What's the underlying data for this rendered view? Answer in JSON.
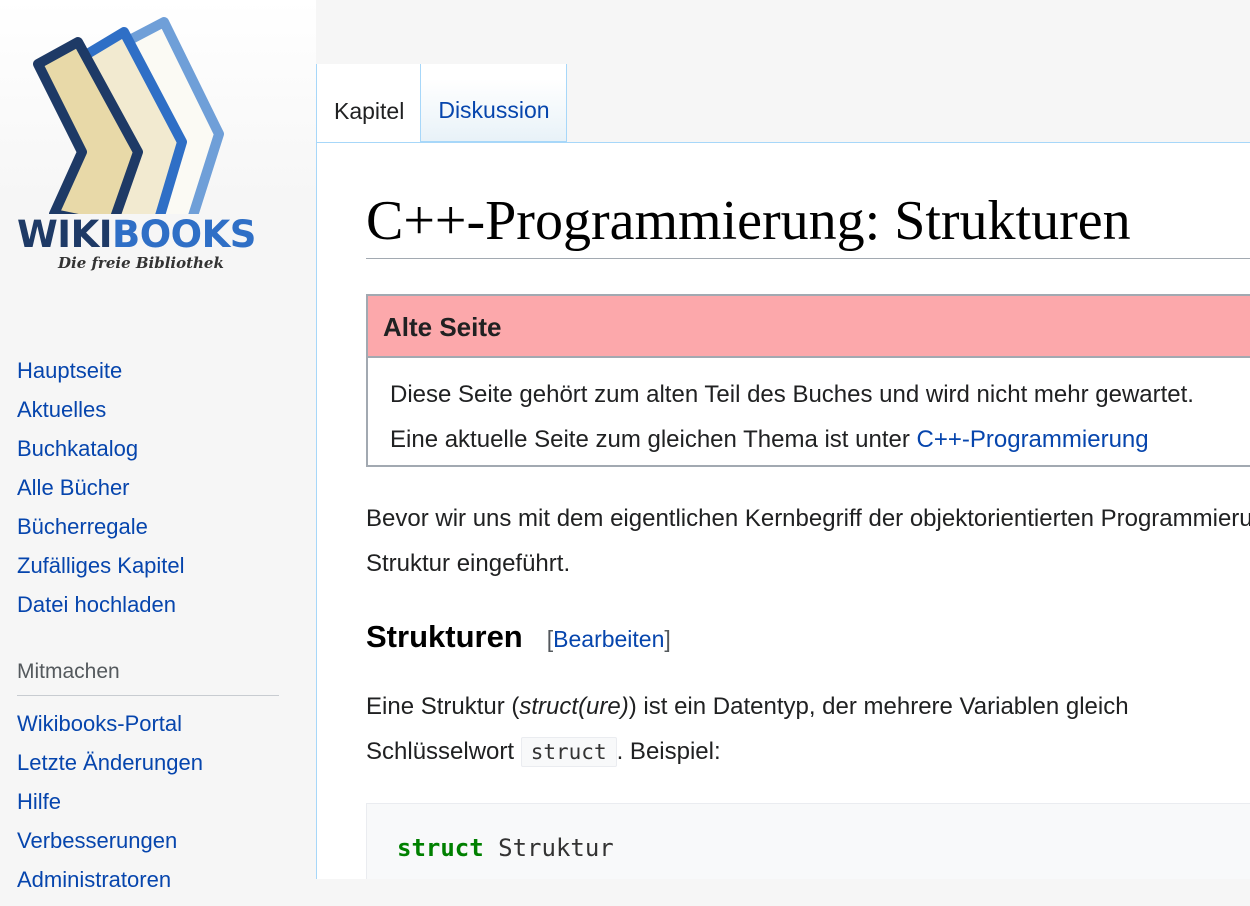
{
  "logo": {
    "wordmark_part1": "WIKI",
    "wordmark_part2": "BOOKS",
    "tagline": "Die freie Bibliothek",
    "colors": {
      "dark_blue": "#1e3a66",
      "mid_blue": "#2f6fc6",
      "light_blue": "#6f9fd8",
      "cream": "#f2ead0"
    }
  },
  "sidebar": {
    "main_items": [
      {
        "label": "Hauptseite"
      },
      {
        "label": "Aktuelles"
      },
      {
        "label": "Buchkatalog"
      },
      {
        "label": "Alle Bücher"
      },
      {
        "label": "Bücherregale"
      },
      {
        "label": "Zufälliges Kapitel"
      },
      {
        "label": "Datei hochladen"
      }
    ],
    "mitmachen_heading": "Mitmachen",
    "mitmachen_items": [
      {
        "label": "Wikibooks-Portal"
      },
      {
        "label": "Letzte Änderungen"
      },
      {
        "label": "Hilfe"
      },
      {
        "label": "Verbesserungen"
      },
      {
        "label": "Administratoren"
      }
    ]
  },
  "tabs": [
    {
      "label": "Kapitel",
      "selected": true
    },
    {
      "label": "Diskussion",
      "selected": false
    }
  ],
  "page": {
    "title": "C++-Programmierung: Strukturen",
    "notice": {
      "title": "Alte Seite",
      "line1": "Diese Seite gehört zum alten Teil des Buches und wird nicht mehr gewartet.",
      "line2_prefix": "Eine aktuelle Seite zum gleichen Thema ist unter ",
      "line2_link": "C++-Programmierung",
      "bg_color": "#fca8ab"
    },
    "intro_line1": "Bevor wir uns mit dem eigentlichen Kernbegriff der objektorientierten Programmierung",
    "intro_line2": "Struktur eingeführt.",
    "section": {
      "title": "Strukturen",
      "edit_open": "[",
      "edit_link": "Bearbeiten",
      "edit_close": "]"
    },
    "para2_prefix": "Eine Struktur (",
    "para2_italic": "struct(ure)",
    "para2_suffix": ") ist ein Datentyp, der mehrere Variablen gleich",
    "para2_line2_prefix": "Schlüsselwort ",
    "para2_code": "struct",
    "para2_line2_suffix": ". Beispiel:",
    "code": {
      "keyword": "struct",
      "name": " Struktur"
    }
  }
}
